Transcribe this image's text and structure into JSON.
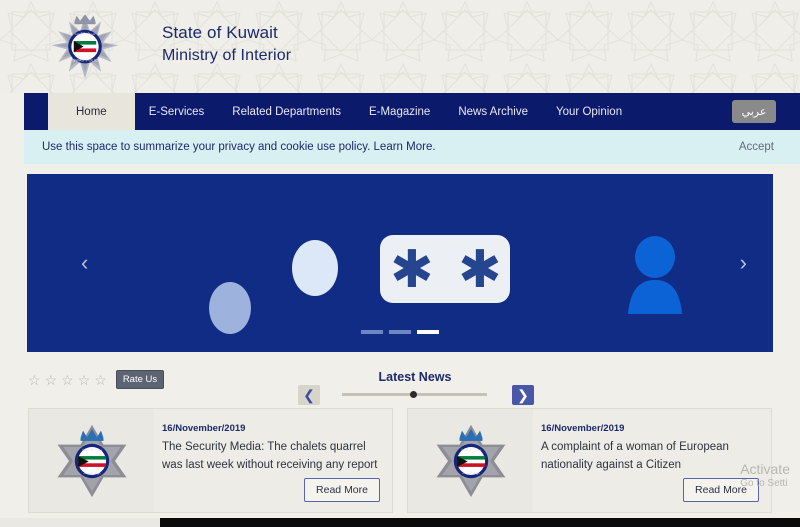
{
  "header": {
    "logo_name": "kuwait-police-badge",
    "title_line1": "State of Kuwait",
    "title_line2": "Ministry of Interior"
  },
  "nav": {
    "items": [
      {
        "label": "Home",
        "active": true
      },
      {
        "label": "E-Services",
        "active": false
      },
      {
        "label": "Related Departments",
        "active": false
      },
      {
        "label": "E-Magazine",
        "active": false
      },
      {
        "label": "News Archive",
        "active": false
      },
      {
        "label": "Your Opinion",
        "active": false
      }
    ],
    "language_button": "عربي"
  },
  "cookie": {
    "text": "Use this space to summarize your privacy and cookie use policy.",
    "link": "Learn More.",
    "accept": "Accept"
  },
  "hero": {
    "prev_icon": "‹",
    "next_icon": "›",
    "asterisk": "✱",
    "slides_total": 3,
    "active_slide": 3,
    "background_color": "#102c85"
  },
  "rating": {
    "star_glyph": "☆",
    "star_count": 5,
    "filled": 0,
    "badge_label": "Rate Us"
  },
  "latest_news": {
    "title": "Latest News",
    "prev_icon": "❮",
    "next_icon": "❯",
    "cards": [
      {
        "date": "16/November/2019",
        "headline": "The Security Media: The chalets quarrel was last week without receiving any report",
        "button": "Read More",
        "thumb_name": "ministry-of-interior-emblem"
      },
      {
        "date": "16/November/2019",
        "headline": "A complaint of a woman of European nationality against a Citizen",
        "button": "Read More",
        "thumb_name": "ministry-of-interior-emblem"
      }
    ]
  },
  "watermark": {
    "line1": "Activate",
    "line2": "Go to Setti"
  },
  "colors": {
    "navy": "#0c1a6b",
    "hero_blue": "#102c85",
    "cookie_bg": "#d9f0f3",
    "page_bg": "#f0efe9",
    "accent_purple": "#4a57a8"
  }
}
